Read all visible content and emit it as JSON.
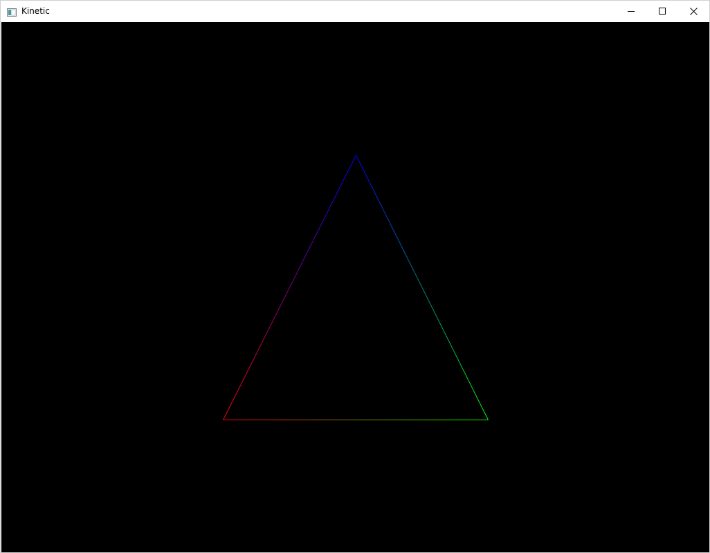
{
  "window": {
    "title": "Kinetic",
    "icon": "app-window-icon",
    "controls": {
      "minimize_icon": "minimize-icon",
      "maximize_icon": "maximize-icon",
      "close_icon": "close-icon"
    }
  },
  "scene": {
    "background_color": "#000000",
    "shape": "triangle",
    "vertex_colors": {
      "top": "#0000ff",
      "bottom_left": "#ff0000",
      "bottom_right": "#00ff00"
    }
  }
}
